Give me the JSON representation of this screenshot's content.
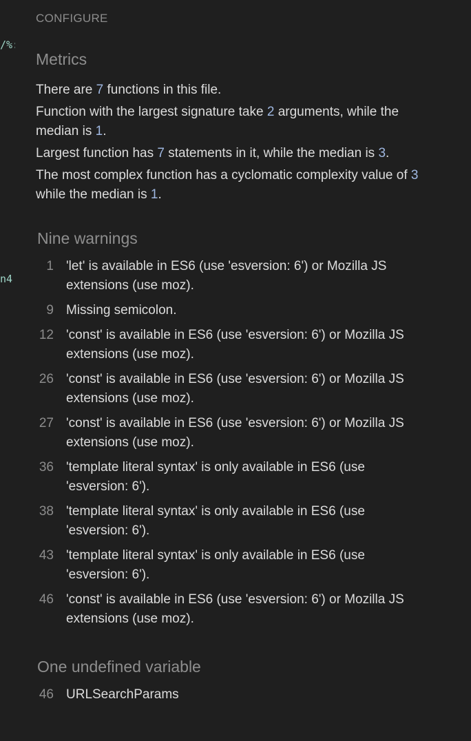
{
  "edge_fragments": [
    "/%:",
    "n4"
  ],
  "header": {
    "configure_label": "CONFIGURE"
  },
  "metrics": {
    "title": "Metrics",
    "functions_count": "7",
    "largest_signature_args": "2",
    "median_args": "1",
    "largest_statements": "7",
    "median_statements": "3",
    "max_complexity": "3",
    "median_complexity": "1",
    "text": {
      "p1_a": "There are ",
      "p1_b": " functions in this file.",
      "p2_a": "Function with the largest signature take ",
      "p2_b": " arguments, while the median is ",
      "p2_c": ".",
      "p3_a": "Largest function has ",
      "p3_b": " statements in it, while the median is ",
      "p3_c": ".",
      "p4_a": "The most complex function has a cyclomatic complexity value of ",
      "p4_b": " while the median is ",
      "p4_c": "."
    }
  },
  "warnings": {
    "title": "Nine warnings",
    "items": [
      {
        "line": "1",
        "message": "'let' is available in ES6 (use 'esversion: 6') or Mozilla JS extensions (use moz)."
      },
      {
        "line": "9",
        "message": "Missing semicolon."
      },
      {
        "line": "12",
        "message": "'const' is available in ES6 (use 'esversion: 6') or Mozilla JS extensions (use moz)."
      },
      {
        "line": "26",
        "message": "'const' is available in ES6 (use 'esversion: 6') or Mozilla JS extensions (use moz)."
      },
      {
        "line": "27",
        "message": "'const' is available in ES6 (use 'esversion: 6') or Mozilla JS extensions (use moz)."
      },
      {
        "line": "36",
        "message": "'template literal syntax' is only available in ES6 (use 'esversion: 6')."
      },
      {
        "line": "38",
        "message": "'template literal syntax' is only available in ES6 (use 'esversion: 6')."
      },
      {
        "line": "43",
        "message": "'template literal syntax' is only available in ES6 (use 'esversion: 6')."
      },
      {
        "line": "46",
        "message": "'const' is available in ES6 (use 'esversion: 6') or Mozilla JS extensions (use moz)."
      }
    ]
  },
  "undefined_vars": {
    "title": "One undefined variable",
    "items": [
      {
        "line": "46",
        "name": "URLSearchParams"
      }
    ]
  }
}
